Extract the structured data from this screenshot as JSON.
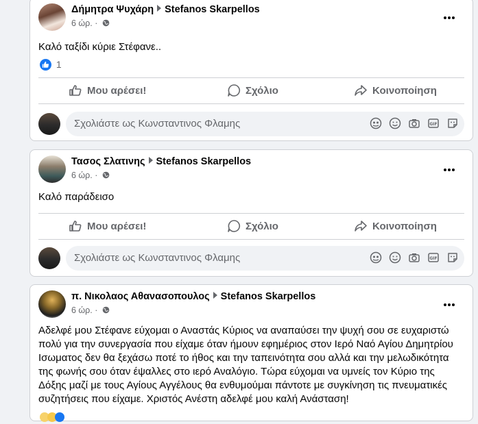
{
  "posts": [
    {
      "author": "Δήμητρα Ψυχάρη",
      "target": "Stefanos Skarpellos",
      "time": "6 ώρ. ·",
      "text": "Καλό ταξίδι κύριε Στέφανε..",
      "reaction_count": "1"
    },
    {
      "author": "Τασος Σλατινης",
      "target": "Stefanos Skarpellos",
      "time": "6 ώρ. ·",
      "text": "Καλό παράδεισο"
    },
    {
      "author": "π. Νικολαος Αθανασοπουλος",
      "target": "Stefanos Skarpellos",
      "time": "6 ώρ. ·",
      "text": "Αδελφέ μου Στέφανε εύχομαι ο Αναστάς Κύριος να αναπαύσει την ψυχή σου σε ευχαριστώ πολύ για την συνεργασία που είχαμε όταν ήμουν εφημέριος στον Ιερό Ναό Αγίου Δημητρίου Ισωματος δεν θα ξεχάσω ποτέ το ήθος και την ταπεινότητα σου αλλά και την μελωδικότητα της φωνής σου όταν έψαλλες στο ιερό Αναλόγιο. Τώρα εύχομαι να υμνείς τον Κύριο της Δόξης μαζί με τους Αγίους Αγγέλους θα ενθυμούμαι πάντοτε με συγκίνηση τις πνευματικές συζητήσεις που είχαμε. Χριστός Ανέστη αδελφέ μου καλή Ανάσταση!"
    }
  ],
  "actions": {
    "like": "Μου αρέσει!",
    "comment": "Σχόλιο",
    "share": "Κοινοποίηση"
  },
  "comment_placeholder": "Σχολιάστε ως Κωνσταντινος Φλαμης",
  "colors": {
    "accent": "#1877f2",
    "secondary_text": "#65676b",
    "divider": "#ced0d4"
  }
}
